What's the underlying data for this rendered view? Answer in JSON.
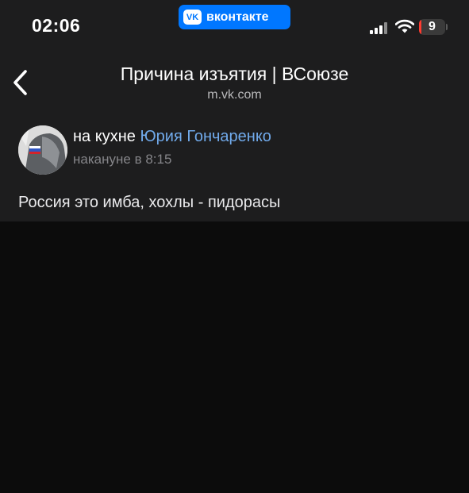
{
  "status_bar": {
    "time": "02:06",
    "app_badge": "вконтакте",
    "app_badge_logo": "VK",
    "battery_level": "9",
    "battery_fraction": 0.09,
    "signal_icon": "cellular-signal-icon",
    "wifi_icon": "wifi-icon",
    "accent_color": "#0077ff",
    "battery_color": "#ff3b30"
  },
  "header": {
    "back_icon": "chevron-left-icon",
    "title": "Причина изъятия | ВСоюзе",
    "subtitle": "m.vk.com"
  },
  "post": {
    "author_prefix": "на кухне",
    "author_name": "Юрия Гончаренко",
    "author_color": "#71aaeb",
    "time": "накануне в 8:15",
    "text": "Россия это имба, хохлы - пидорасы"
  }
}
